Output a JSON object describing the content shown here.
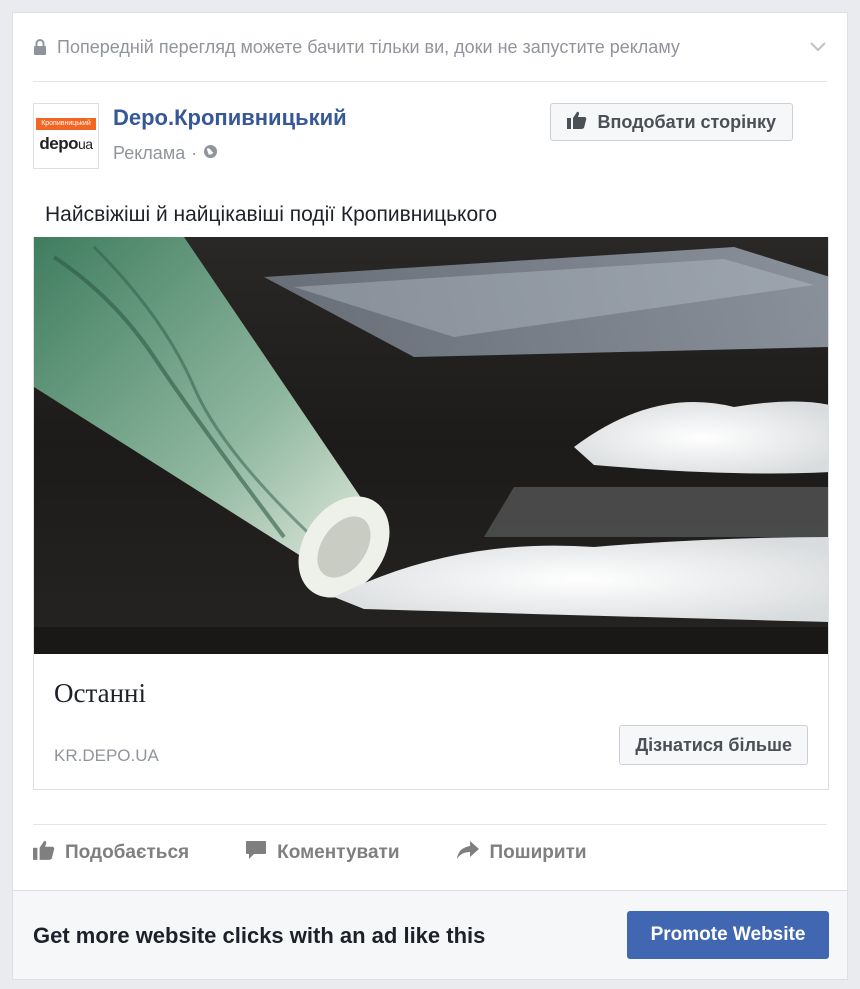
{
  "preview": {
    "notice": "Попередній перегляд можете бачити тільки ви, доки не запустите рекламу",
    "lock_icon": "lock-icon",
    "menu_icon": "chevron-down-icon"
  },
  "page": {
    "name": "Depo.Кропивницький",
    "sponsored": "Реклама",
    "separator": "·",
    "audience_icon": "globe-icon",
    "avatar": {
      "band_text": "Кропивницький",
      "logo_main": "depo",
      "logo_suffix": "ua",
      "brand_color": "#f26522"
    },
    "like_button": "Вподобати сторінку"
  },
  "post": {
    "text": "Найсвіжіші й найцікавіші події Кропивницького"
  },
  "link": {
    "title": "Останні",
    "domain": "KR.DEPO.UA",
    "cta": "Дізнатися більше"
  },
  "actions": [
    {
      "label": "Подобається",
      "icon": "thumbs-up-icon"
    },
    {
      "label": "Коментувати",
      "icon": "comment-icon"
    },
    {
      "label": "Поширити",
      "icon": "share-icon"
    }
  ],
  "promo": {
    "text": "Get more website clicks with an ad like this",
    "button": "Promote Website",
    "button_color": "#4267b2"
  },
  "colors": {
    "link_blue": "#365899",
    "meta_gray": "#90949c"
  }
}
